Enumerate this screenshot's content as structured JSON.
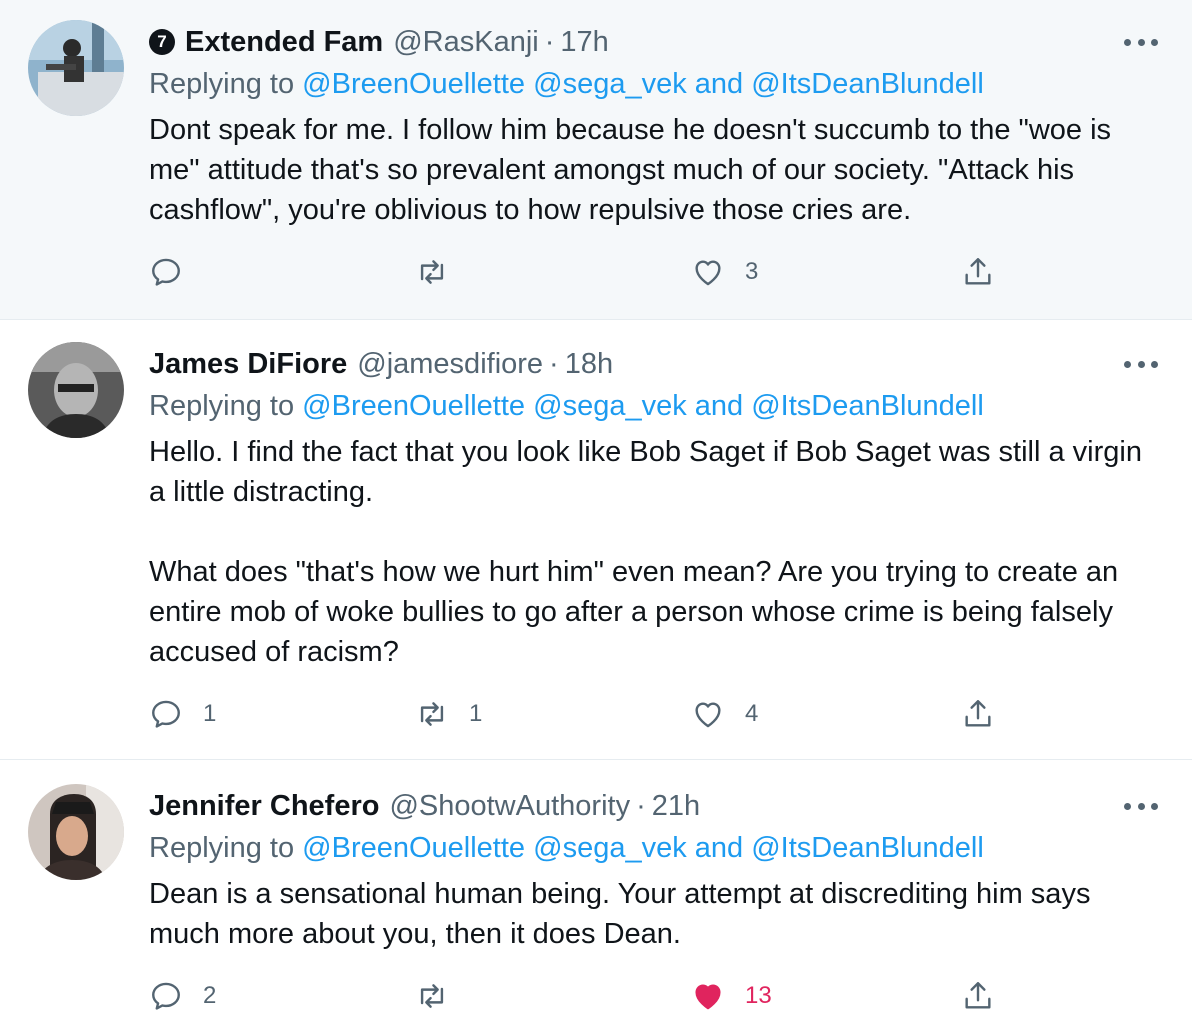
{
  "tweets": [
    {
      "badge": "7",
      "name": "Extended Fam",
      "handle": "@RasKanji",
      "sep": "·",
      "time": "17h",
      "replying_prefix": "Replying to",
      "mention1": "@BreenOuellette",
      "mention2": "@sega_vek",
      "and_text": "and",
      "mention3": "@ItsDeanBlundell",
      "text": "Dont speak for me. I follow him because he doesn't succumb to the \"woe is me\" attitude that's so prevalent amongst much of our society. \"Attack his cashflow\", you're oblivious to how repulsive those cries are.",
      "reply_count": "",
      "retweet_count": "",
      "like_count": "3",
      "liked": false
    },
    {
      "name": "James DiFiore",
      "handle": "@jamesdifiore",
      "sep": "·",
      "time": "18h",
      "replying_prefix": "Replying to",
      "mention1": "@BreenOuellette",
      "mention2": "@sega_vek",
      "and_text": "and",
      "mention3": "@ItsDeanBlundell",
      "text": "Hello. I find the fact that you look like Bob Saget if Bob Saget was still a virgin a little distracting.\n\nWhat does \"that's how we hurt him\" even mean? Are you trying to create an entire mob of woke bullies to go after a person whose crime is being falsely accused of racism?",
      "reply_count": "1",
      "retweet_count": "1",
      "like_count": "4",
      "liked": false
    },
    {
      "name": "Jennifer Chefero",
      "handle": "@ShootwAuthority",
      "sep": "·",
      "time": "21h",
      "replying_prefix": "Replying to",
      "mention1": "@BreenOuellette",
      "mention2": "@sega_vek",
      "and_text": "and",
      "mention3": "@ItsDeanBlundell",
      "text": "Dean is a sensational human being. Your attempt at discrediting him says much more about you, then it does Dean.",
      "reply_count": "2",
      "retweet_count": "",
      "like_count": "13",
      "liked": true
    }
  ],
  "icons": {
    "reply": "reply-icon",
    "retweet": "retweet-icon",
    "like": "heart-icon",
    "share": "share-icon",
    "more": "more-icon"
  },
  "colors": {
    "link": "#1d9bf0",
    "muted": "#536471",
    "like_active": "#e0245e",
    "highlight_bg": "#f5f8fa"
  }
}
